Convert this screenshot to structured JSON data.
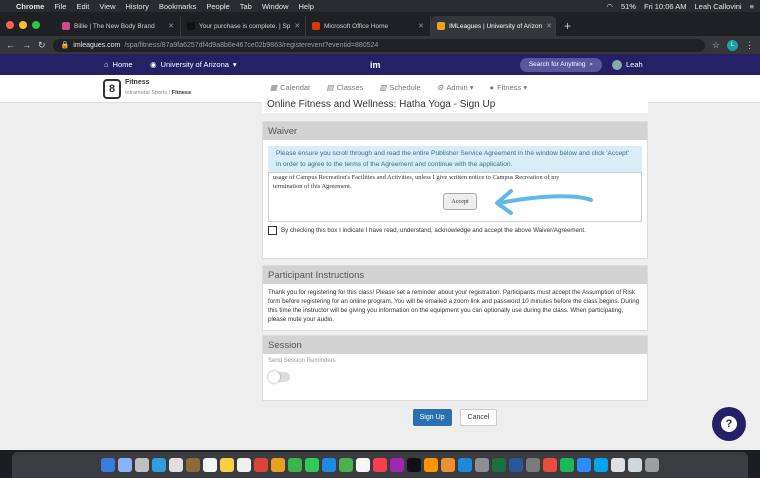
{
  "mac_menubar": {
    "app": "Chrome",
    "items": [
      "File",
      "Edit",
      "View",
      "History",
      "Bookmarks",
      "People",
      "Tab",
      "Window",
      "Help"
    ],
    "battery": "51%",
    "clock": "Fri 10:06 AM",
    "user": "Leah Callovini"
  },
  "tabs": [
    {
      "label": "Billie | The New Body Brand",
      "color": "#d04a8a",
      "active": false
    },
    {
      "label": "Your purchase is complete. | Sp",
      "color": "#222222",
      "active": false
    },
    {
      "label": "Microsoft Office Home",
      "color": "#d83b01",
      "active": false
    },
    {
      "label": "IMLeagues | University of Arizon",
      "color": "#f0a020",
      "active": true
    }
  ],
  "toolbar": {
    "url_host": "imleagues.com",
    "url_path": "/spa/fitness/87a9fa6257df4d9a8b6e467ce02b9863/registerevent?eventid=880524",
    "profile_initial": "L"
  },
  "site_nav": {
    "home": "Home",
    "university": "University of Arizona",
    "search": "Search for Anything",
    "user": "Leah"
  },
  "sub_nav": {
    "badge": "8",
    "title": "Fitness",
    "crumb_parent": "Intramural Sports",
    "crumb_current": "Fitness",
    "menu": [
      "Calendar",
      "Classes",
      "Schedule",
      "Admin ▾",
      "Fitness ▾"
    ]
  },
  "page_title": "Online Fitness and Wellness: Hatha Yoga - Sign Up",
  "waiver": {
    "heading": "Waiver",
    "info": "Please ensure you scroll through and read the entire Publisher Service Agreement in the window below and click 'Accept' in order to agree to the terms of the Agreement and continue with the application.",
    "agreement_text_1": "usage of Campus Recreation's Facilities and Activities, unless I give written notice to Campus Recreation of my",
    "agreement_text_2": "termination of this Agreement.",
    "accept_label": "Accept",
    "checkbox_label": "By checking this box I indicate I have read, understand, acknowledge and accept the above Waiver/Agreement."
  },
  "participant": {
    "heading": "Participant Instructions",
    "text": "Thank you for registering for this class! Please set a reminder about your registration. Participants must accept the Assumption of Risk form before registering for an online program. You will be emailed a zoom link and password 10 minutes before the class begins. During this time the instructor will be giving you information on the equipment you can optionally use during the class. When participating, please mute your audio."
  },
  "session": {
    "heading": "Session",
    "reminder_label": "Send Session Reminders",
    "reminders_enabled": false
  },
  "actions": {
    "sign_up": "Sign Up",
    "cancel": "Cancel"
  },
  "help": "?",
  "colors": {
    "brand_navy": "#262067",
    "primary_button": "#2a6fae",
    "info_bg": "#d9edf7",
    "annotation_arrow": "#5fb8e6"
  }
}
